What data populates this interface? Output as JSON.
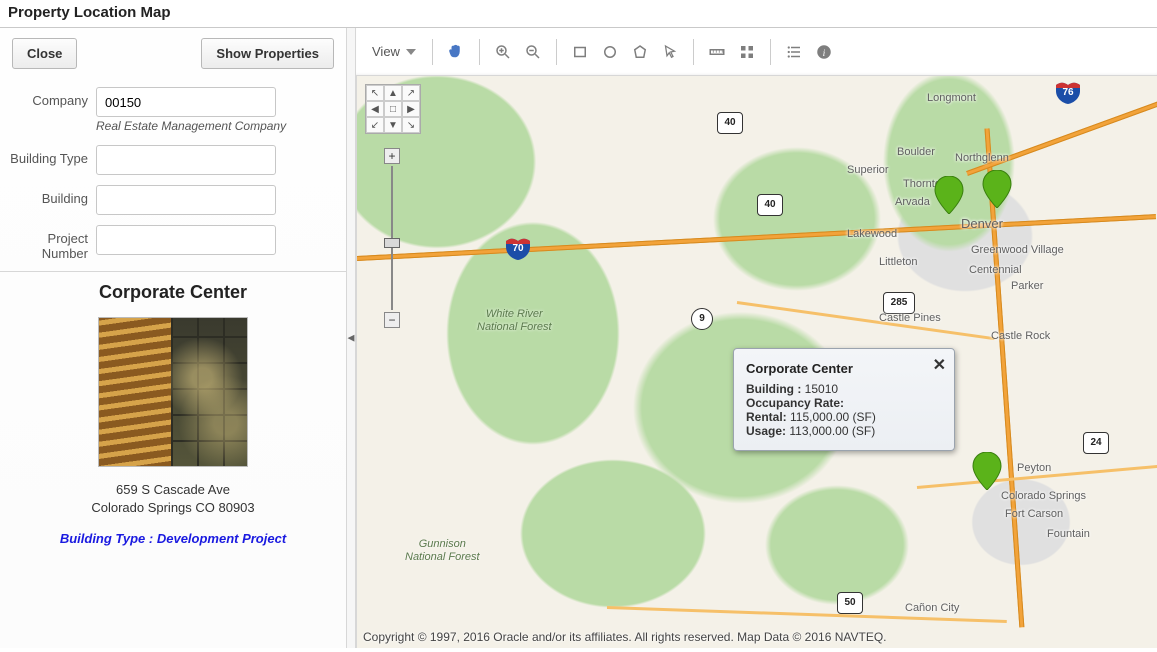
{
  "page_title": "Property Location Map",
  "sidebar": {
    "close_label": "Close",
    "show_properties_label": "Show Properties",
    "fields": {
      "company": {
        "label": "Company",
        "value": "00150",
        "help": "Real Estate Management Company"
      },
      "building_type": {
        "label": "Building Type",
        "value": ""
      },
      "building": {
        "label": "Building",
        "value": ""
      },
      "project_number": {
        "label": "Project Number",
        "value": ""
      }
    },
    "property_card": {
      "title": "Corporate Center",
      "address_line1": "659 S Cascade Ave",
      "address_line2": "Colorado Springs CO 80903",
      "building_type_line": "Building Type : Development Project"
    }
  },
  "toolbar": {
    "view_label": "View"
  },
  "map": {
    "forests": {
      "white_river": "White River\nNational Forest",
      "gunnison": "Gunnison\nNational Forest"
    },
    "cities": {
      "longmont": "Longmont",
      "boulder": "Boulder",
      "superior": "Superior",
      "northglenn": "Northglenn",
      "thornton": "Thornton",
      "arvada": "Arvada",
      "denver": "Denver",
      "lakewood": "Lakewood",
      "littleton": "Littleton",
      "greenwood": "Greenwood Village",
      "centennial": "Centennial",
      "parker": "Parker",
      "castle_pines": "Castle Pines",
      "castle_rock": "Castle Rock",
      "peyton": "Peyton",
      "colorado_springs": "Colorado Springs",
      "fort_carson": "Fort Carson",
      "fountain": "Fountain",
      "canon_city": "Cañon City"
    },
    "shields": {
      "i70": "70",
      "i76": "76",
      "us40a": "40",
      "us40b": "40",
      "us285": "285",
      "us24": "24",
      "us50": "50",
      "co9": "9"
    },
    "info_popup": {
      "title": "Corporate Center",
      "building_label": "Building :",
      "building_value": "15010",
      "occupancy_label": "Occupancy Rate:",
      "rental_label": "Rental:",
      "rental_value": "115,000.00 (SF)",
      "usage_label": "Usage:",
      "usage_value": "113,000.00 (SF)"
    },
    "copyright": "Copyright © 1997, 2016 Oracle and/or its affiliates. All rights reserved. Map Data © 2016 NAVTEQ."
  }
}
